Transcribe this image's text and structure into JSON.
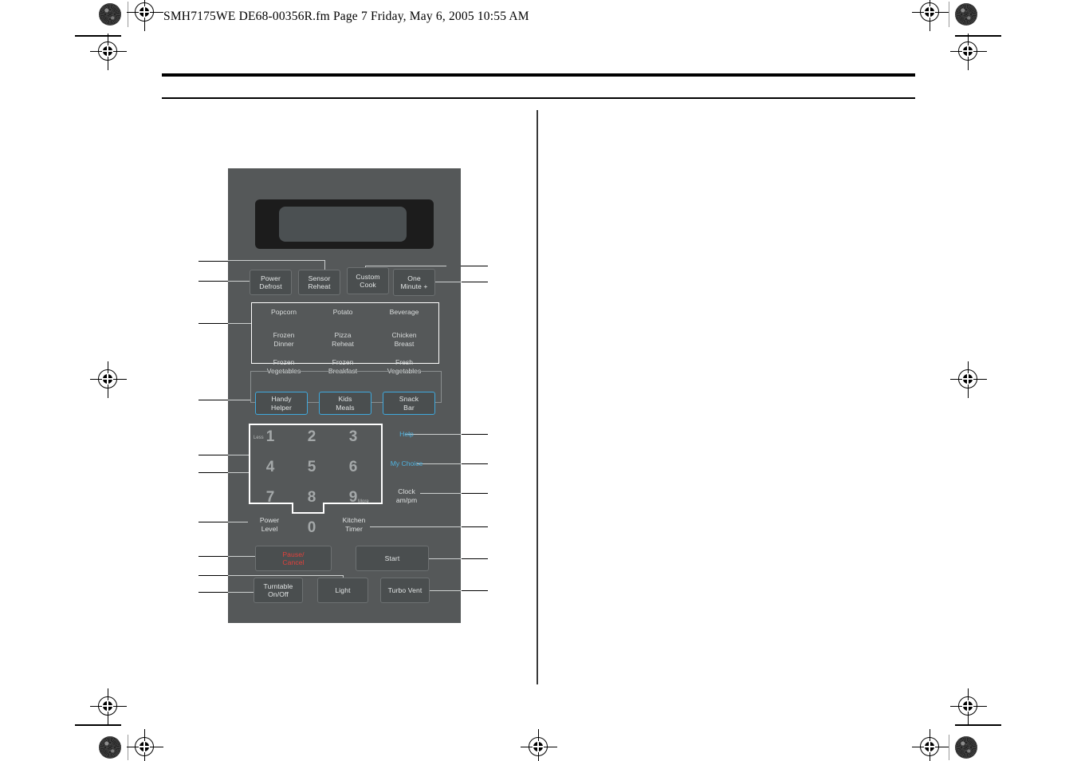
{
  "page": {
    "header": "SMH7175WE DE68-00356R.fm  Page 7  Friday, May 6, 2005  10:55 AM",
    "accent_cyan": "#3fa9dd",
    "accent_red": "#e2413b",
    "panel_bg": "#555859"
  },
  "panel": {
    "display": {
      "label": "display-screen"
    },
    "top_row": [
      {
        "label": "Power\nDefrost",
        "name": "power-defrost-button"
      },
      {
        "label": "Sensor\nReheat",
        "name": "sensor-reheat-button"
      },
      {
        "label": "Custom\nCook",
        "name": "custom-cook-button"
      },
      {
        "label": "One\nMinute +",
        "name": "one-minute-plus-button"
      }
    ],
    "presets": [
      {
        "label": "Popcorn",
        "name": "preset-popcorn"
      },
      {
        "label": "Potato",
        "name": "preset-potato"
      },
      {
        "label": "Beverage",
        "name": "preset-beverage"
      },
      {
        "label": "Frozen\nDinner",
        "name": "preset-frozen-dinner"
      },
      {
        "label": "Pizza\nReheat",
        "name": "preset-pizza-reheat"
      },
      {
        "label": "Chicken\nBreast",
        "name": "preset-chicken-breast"
      },
      {
        "label": "Frozen\nVegetables",
        "name": "preset-frozen-vegetables"
      },
      {
        "label": "Frozen\nBreakfast",
        "name": "preset-frozen-breakfast"
      },
      {
        "label": "Fresh\nVegetables",
        "name": "preset-fresh-vegetables"
      }
    ],
    "helper_row": [
      {
        "label": "Handy\nHelper",
        "name": "handy-helper-button"
      },
      {
        "label": "Kids\nMeals",
        "name": "kids-meals-button"
      },
      {
        "label": "Snack\nBar",
        "name": "snack-bar-button"
      }
    ],
    "keypad": {
      "digits": [
        "1",
        "2",
        "3",
        "4",
        "5",
        "6",
        "7",
        "8",
        "9",
        "0"
      ],
      "less_label": "Less",
      "more_label": "More"
    },
    "side_labels": [
      {
        "label": "Help",
        "name": "help-button",
        "color": "cyan"
      },
      {
        "label": "My Choice",
        "name": "my-choice-button",
        "color": "cyan"
      },
      {
        "label": "Clock\nam/pm",
        "name": "clock-ampm-button",
        "color": "white"
      }
    ],
    "lower_labels": [
      {
        "label": "Power\nLevel",
        "name": "power-level-button"
      },
      {
        "label": "Kitchen\nTimer",
        "name": "kitchen-timer-button"
      }
    ],
    "action_row": [
      {
        "label": "Pause/\nCancel",
        "name": "pause-cancel-button",
        "style": "red"
      },
      {
        "label": "Start",
        "name": "start-button",
        "style": "plain"
      }
    ],
    "bottom_row": [
      {
        "label": "Turntable\nOn/Off",
        "name": "turntable-on-off-button"
      },
      {
        "label": "Light",
        "name": "light-button"
      },
      {
        "label": "Turbo Vent",
        "name": "turbo-vent-button"
      }
    ]
  }
}
